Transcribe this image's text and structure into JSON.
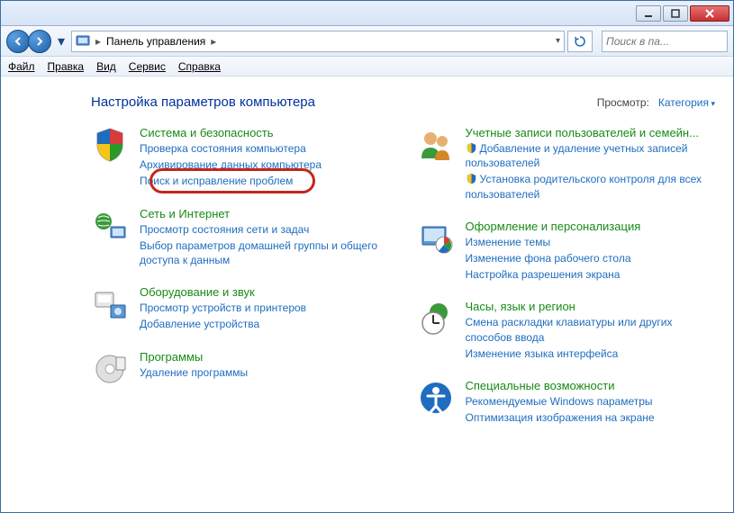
{
  "titlebar": {},
  "nav": {
    "breadcrumb": "Панель управления",
    "separator": "▸"
  },
  "search": {
    "placeholder": "Поиск в па..."
  },
  "menu": {
    "file": "Файл",
    "edit": "Правка",
    "view": "Вид",
    "service": "Сервис",
    "help": "Справка"
  },
  "heading": "Настройка параметров компьютера",
  "viewBy": {
    "label": "Просмотр:",
    "value": "Категория"
  },
  "left": [
    {
      "title": "Система и безопасность",
      "links": [
        "Проверка состояния компьютера",
        "Архивирование данных компьютера",
        "Поиск и исправление проблем"
      ]
    },
    {
      "title": "Сеть и Интернет",
      "links": [
        "Просмотр состояния сети и задач",
        "Выбор параметров домашней группы и общего доступа к данным"
      ]
    },
    {
      "title": "Оборудование и звук",
      "links": [
        "Просмотр устройств и принтеров",
        "Добавление устройства"
      ]
    },
    {
      "title": "Программы",
      "links": [
        "Удаление программы"
      ]
    }
  ],
  "right": [
    {
      "title": "Учетные записи пользователей и семейн...",
      "links": [
        {
          "shield": true,
          "text": "Добавление и удаление учетных записей пользователей"
        },
        {
          "shield": true,
          "text": "Установка родительского контроля для всех пользователей"
        }
      ]
    },
    {
      "title": "Оформление и персонализация",
      "links": [
        "Изменение темы",
        "Изменение фона рабочего стола",
        "Настройка разрешения экрана"
      ]
    },
    {
      "title": "Часы, язык и регион",
      "links": [
        "Смена раскладки клавиатуры или других способов ввода",
        "Изменение языка интерфейса"
      ]
    },
    {
      "title": "Специальные возможности",
      "links": [
        "Рекомендуемые Windows параметры",
        "Оптимизация изображения на экране"
      ]
    }
  ]
}
